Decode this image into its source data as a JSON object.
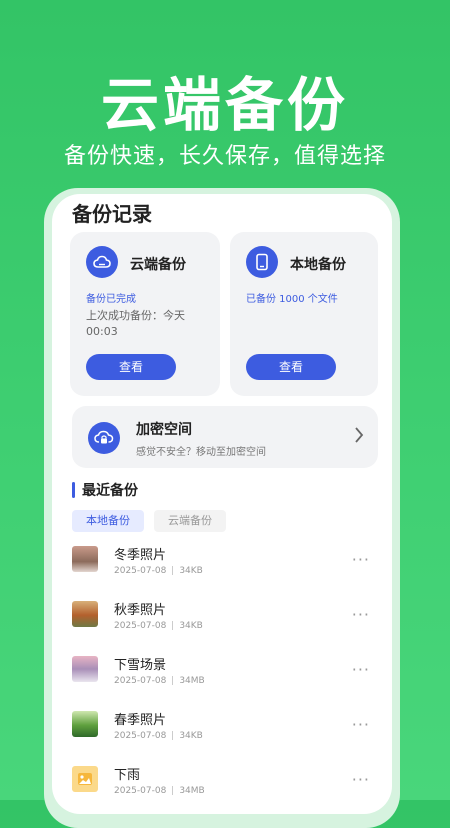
{
  "hero": {
    "title": "云端备份",
    "subtitle": "备份快速，长久保存，值得选择"
  },
  "page_title": "备份记录",
  "cards": {
    "cloud": {
      "name": "云端备份",
      "status": "备份已完成",
      "desc": "上次成功备份：今天00:03",
      "button": "查看"
    },
    "local": {
      "name": "本地备份",
      "status": "已备份 1000 个文件",
      "button": "查看"
    }
  },
  "secure": {
    "title": "加密空间",
    "subtitle": "感觉不安全？移动至加密空间"
  },
  "recent": {
    "title": "最近备份",
    "tabs": [
      "本地备份",
      "云端备份"
    ],
    "items": [
      {
        "title": "冬季照片",
        "date": "2025-07-08",
        "size": "34KB"
      },
      {
        "title": "秋季照片",
        "date": "2025-07-08",
        "size": "34KB"
      },
      {
        "title": "下雪场景",
        "date": "2025-07-08",
        "size": "34MB"
      },
      {
        "title": "春季照片",
        "date": "2025-07-08",
        "size": "34KB"
      },
      {
        "title": "下雨",
        "date": "2025-07-08",
        "size": "34MB"
      }
    ],
    "more_label": "···"
  },
  "colors": {
    "accent": "#3d5ce0",
    "background": "#3fcf72"
  }
}
